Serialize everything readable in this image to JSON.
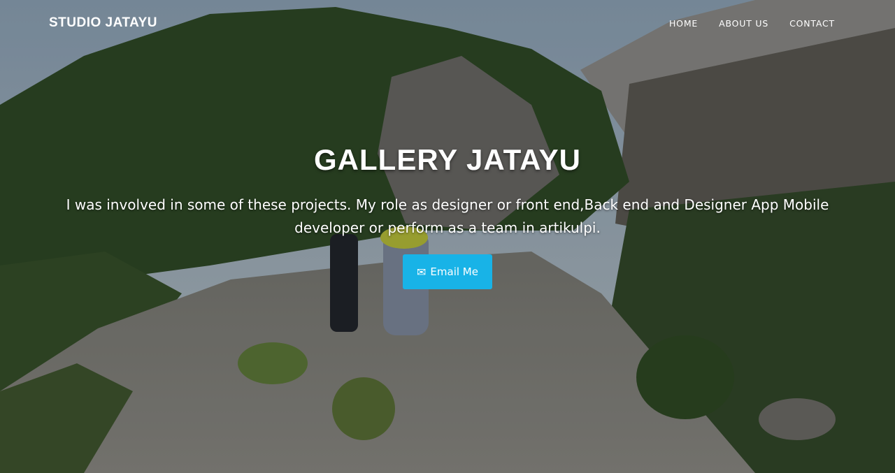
{
  "header": {
    "brand": "STUDIO JATAYU",
    "nav": [
      {
        "label": "HOME"
      },
      {
        "label": "ABOUT US"
      },
      {
        "label": "CONTACT"
      }
    ]
  },
  "hero": {
    "title": "GALLERY JATAYU",
    "subtitle": "I was involved in some of these projects. My role as designer or front end,Back end and Designer App Mobile developer or perform as a team in artikulpi.",
    "cta": {
      "label": "Email Me",
      "icon": "envelope-icon"
    }
  },
  "colors": {
    "accent": "#18b3e7",
    "text": "#ffffff"
  }
}
